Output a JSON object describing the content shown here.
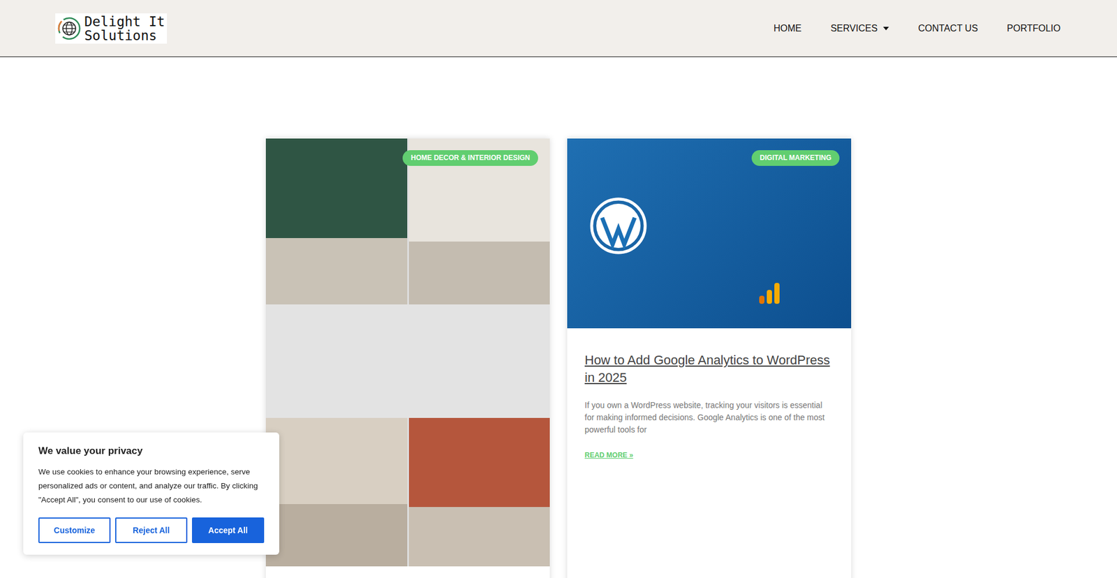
{
  "header": {
    "logo": {
      "line1": "Delight It",
      "line2": "Solutions"
    },
    "nav": [
      {
        "label": "HOME",
        "has_dropdown": false
      },
      {
        "label": "SERVICES",
        "has_dropdown": true
      },
      {
        "label": "CONTACT US",
        "has_dropdown": false
      },
      {
        "label": "PORTFOLIO",
        "has_dropdown": false
      }
    ]
  },
  "posts": [
    {
      "kind": "tall",
      "category": "HOME DECOR & INTERIOR DESIGN"
    },
    {
      "kind": "standard",
      "category": "DIGITAL MARKETING",
      "title": "How to Add Google Analytics to WordPress in 2025",
      "excerpt": "If you own a WordPress website, tracking your visitors is essential for making informed decisions. Google Analytics is one of the most powerful tools for",
      "read_more": "READ MORE »"
    }
  ],
  "cookie_banner": {
    "title": "We value your privacy",
    "text": "We use cookies to enhance your browsing experience, serve personalized ads or content, and analyze our traffic. By clicking \"Accept All\", you consent to our use of cookies.",
    "buttons": [
      {
        "label": "Customize",
        "primary": false
      },
      {
        "label": "Reject All",
        "primary": false
      },
      {
        "label": "Accept All",
        "primary": true
      }
    ]
  }
}
